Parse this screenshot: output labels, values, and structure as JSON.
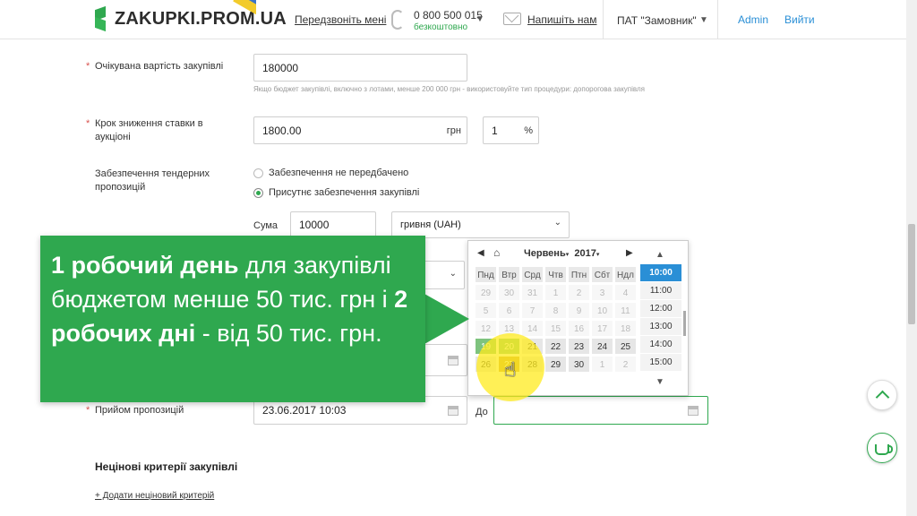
{
  "header": {
    "logo_text": "ZAKUPKI.PROM.UA",
    "call_label": "Передзвоніть мені",
    "phone": "0 800 500 015",
    "phone_note": "безкоштовно",
    "write_label": "Напишіть нам",
    "org_select": "ПАТ \"Замовник\"",
    "admin_label": "Admin",
    "logout_label": "Вийти"
  },
  "form": {
    "expected_cost": {
      "label": "Очікувана вартість закупівлі",
      "value": "180000",
      "hint": "Якщо бюджет закупівлі, включно з лотами, менше 200 000 грн - використовуйте тип процедури: допорогова закупівля"
    },
    "auction_step": {
      "label_line1": "Крок зниження ставки в",
      "label_line2": "аукціоні",
      "value": "1800.00",
      "currency": "грн",
      "percent_value": "1",
      "percent_sign": "%"
    },
    "security": {
      "label_line1": "Забезпечення тендерних",
      "label_line2": "пропозицій",
      "options": [
        "Забезпечення не передбачено",
        "Присутнє забезпечення закупівлі"
      ],
      "selected_index": 1,
      "sum_label": "Сума",
      "sum_value": "10000",
      "currency": "гривня (UAH)"
    },
    "submission": {
      "label": "Прийом пропозицій",
      "from_value": "23.06.2017 10:03",
      "to_label": "До",
      "to_value": ""
    },
    "nonprice_title": "Нецінові критерії закупівлі",
    "add_nonprice": "+ Додати нецінoвий критерій"
  },
  "datepicker": {
    "month": "Червень",
    "year": "2017",
    "weekdays": [
      "Пнд",
      "Втр",
      "Срд",
      "Чтв",
      "Птн",
      "Сбт",
      "Ндл"
    ],
    "weeks": [
      [
        "29",
        "30",
        "31",
        "1",
        "2",
        "3",
        "4"
      ],
      [
        "5",
        "6",
        "7",
        "8",
        "9",
        "10",
        "11"
      ],
      [
        "12",
        "13",
        "14",
        "15",
        "16",
        "17",
        "18"
      ],
      [
        "19",
        "20",
        "21",
        "22",
        "23",
        "24",
        "25"
      ],
      [
        "26",
        "27",
        "28",
        "29",
        "30",
        "1",
        "2"
      ]
    ],
    "times": [
      "10:00",
      "11:00",
      "12:00",
      "13:00",
      "14:00",
      "15:00"
    ],
    "selected_time": "10:00"
  },
  "callout": {
    "bold1": "1 робочий день",
    "text1": " для закупівлі бюджетом менше 50 тис. грн і ",
    "bold2": "2 робочих дні",
    "text2": " - від 50 тис. грн."
  },
  "colors": {
    "brand_green": "#2fa84f",
    "link_blue": "#2a8fd6",
    "highlight_yellow": "#ffeb1e"
  }
}
